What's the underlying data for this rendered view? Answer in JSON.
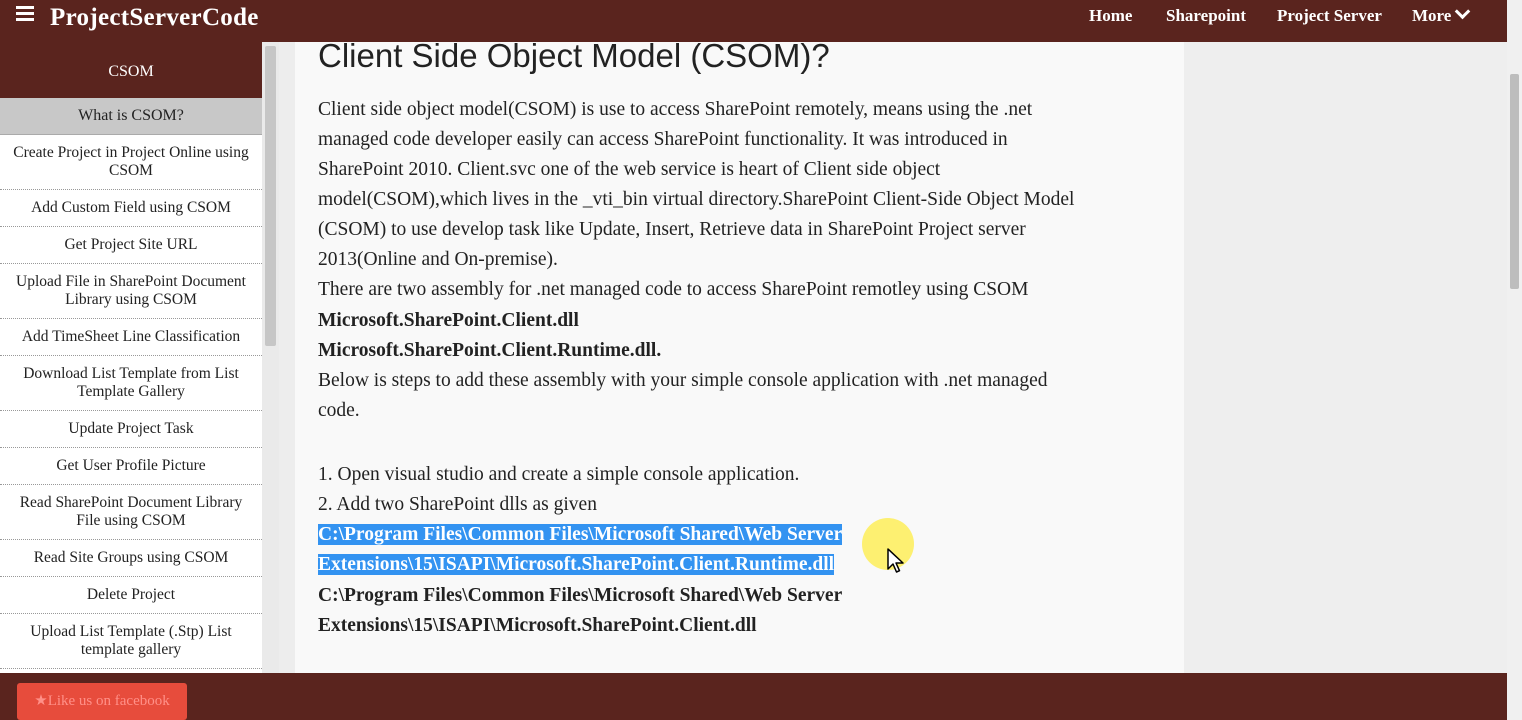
{
  "brand": "ProjectServerCode",
  "nav": {
    "home": "Home",
    "sharepoint": "Sharepoint",
    "project_server": "Project Server",
    "more": "More"
  },
  "sidebar": {
    "header": "CSOM",
    "active": "What is CSOM?",
    "items": [
      "Create Project in Project Online using CSOM",
      "Add Custom Field using CSOM",
      "Get Project Site URL",
      "Upload File in SharePoint Document Library using CSOM",
      "Add TimeSheet Line Classification",
      "Download List Template from List Template Gallery",
      "Update Project Task",
      "Get User Profile Picture",
      "Read SharePoint Document Library File using CSOM",
      "Read Site Groups using CSOM",
      "Delete Project",
      "Upload List Template (.Stp) List template gallery"
    ]
  },
  "article": {
    "title": "Client Side Object Model (CSOM)?",
    "lines": [
      "Client side object model(CSOM) is use to access SharePoint remotely, means using the .net",
      "managed code developer easily can access SharePoint functionality. It was introduced in",
      "SharePoint 2010. Client.svc one of the web service is heart of Client side object",
      "model(CSOM),which lives in the _vti_bin virtual directory.SharePoint Client-Side Object Model",
      "(CSOM) to use develop task like Update, Insert, Retrieve data in SharePoint Project server",
      "2013(Online and On-premise).",
      "There are two assembly for .net managed code to access SharePoint remotley using CSOM"
    ],
    "dll1": "Microsoft.SharePoint.Client.dll",
    "dll2": "Microsoft.SharePoint.Client.Runtime.dll.",
    "steps_intro_1": "Below is steps to add these assembly with your simple console application with .net managed",
    "steps_intro_2": "code.",
    "step1": "1. Open visual studio and create a simple console application.",
    "step2": "2. Add two SharePoint dlls as given",
    "path1_line1": "C:\\Program Files\\Common Files\\Microsoft Shared\\Web Server",
    "path1_line2": "Extensions\\15\\ISAPI\\Microsoft.SharePoint.Client.Runtime.dll",
    "path2_line1": "C:\\Program Files\\Common Files\\Microsoft Shared\\Web Server",
    "path2_line2": "Extensions\\15\\ISAPI\\Microsoft.SharePoint.Client.dll"
  },
  "footer": {
    "button": "★Like us on facebook"
  },
  "colors": {
    "brand_bar": "#5a241e",
    "selection": "#3393f1",
    "footer_button": "#e74c3c"
  }
}
